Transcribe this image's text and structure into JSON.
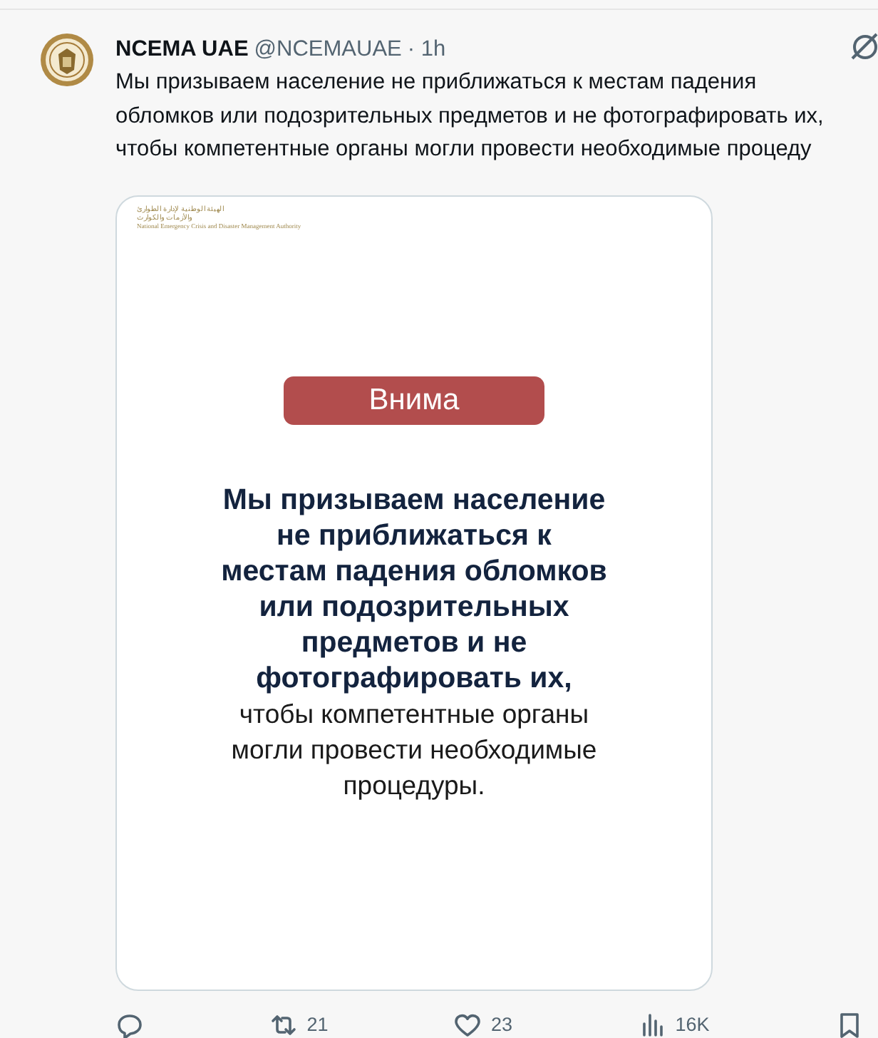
{
  "tweet": {
    "author": {
      "name": "NCEMA UAE",
      "handle": "@NCEMAUAE",
      "time": "· 1h"
    },
    "text_lines": [
      "Мы призываем население не приближаться к местам падения",
      "обломков или подозрительных предметов и не фотографировать их,",
      "чтобы компетентные органы могли провести необходимые процеду"
    ],
    "image": {
      "header_arabic": "الهيئة الوطنية لإدارة الطوارئ والأزمات والكوارث",
      "header_english": "National Emergency Crisis and Disaster Management Authority",
      "banner": "Внима",
      "message": "**Мы призываем население\nне приближаться к\nместам падения обломков\nили подозрительных\nпредметов и не\nфотографировать их,**\nчтобы компетентные органы\nмогли провести необходимые\nпроцедуры."
    },
    "actions": [
      {
        "kind": "reply"
      },
      {
        "kind": "retweet",
        "count": "21"
      },
      {
        "kind": "like",
        "count": "23"
      },
      {
        "kind": "views",
        "count": "16K"
      },
      {
        "kind": "bookmark"
      }
    ]
  }
}
